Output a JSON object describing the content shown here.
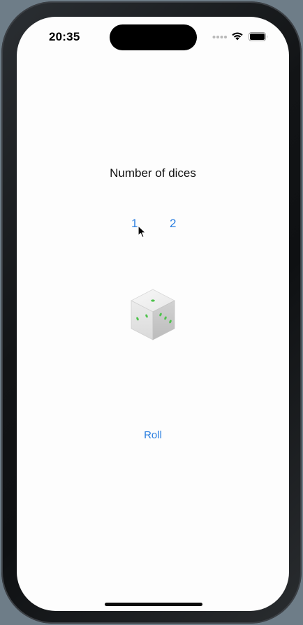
{
  "status_bar": {
    "time": "20:35",
    "icons": [
      "cellular-signal-icon",
      "wifi-icon",
      "battery-icon"
    ]
  },
  "main": {
    "title": "Number of dices",
    "dice_count_options": [
      "1",
      "2"
    ],
    "selected_count": "1",
    "roll_label": "Roll",
    "dice_icon": "dice-icon"
  },
  "colors": {
    "accent": "#2a7ee0",
    "background": "#fdfdfd",
    "pip_green": "#4cc24a"
  }
}
